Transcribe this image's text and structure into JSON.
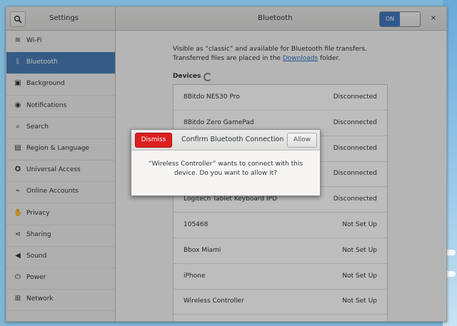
{
  "window": {
    "sidebar_title": "Settings",
    "title": "Bluetooth",
    "switch_label": "ON",
    "close_glyph": "×"
  },
  "sidebar": {
    "items": [
      {
        "label": "Wi-Fi",
        "icon": "wifi-icon",
        "glyph": "≋",
        "active": false
      },
      {
        "label": "Bluetooth",
        "icon": "bluetooth-icon",
        "glyph": "ᛒ",
        "active": true
      },
      {
        "label": "Background",
        "icon": "background-icon",
        "glyph": "▣",
        "active": false
      },
      {
        "label": "Notifications",
        "icon": "bell-icon",
        "glyph": "◉",
        "active": false
      },
      {
        "label": "Search",
        "icon": "search-icon",
        "glyph": "⌕",
        "active": false
      },
      {
        "label": "Region & Language",
        "icon": "flag-icon",
        "glyph": "▤",
        "active": false
      },
      {
        "label": "Universal Access",
        "icon": "accessibility-icon",
        "glyph": "✪",
        "active": false
      },
      {
        "label": "Online Accounts",
        "icon": "accounts-icon",
        "glyph": "⌁",
        "active": false
      },
      {
        "label": "Privacy",
        "icon": "privacy-icon",
        "glyph": "✋",
        "active": false
      },
      {
        "label": "Sharing",
        "icon": "share-icon",
        "glyph": "⋖",
        "active": false
      },
      {
        "label": "Sound",
        "icon": "speaker-icon",
        "glyph": "◀",
        "active": false
      },
      {
        "label": "Power",
        "icon": "power-icon",
        "glyph": "⏻",
        "active": false
      },
      {
        "label": "Network",
        "icon": "network-icon",
        "glyph": "⊞",
        "active": false
      }
    ]
  },
  "main": {
    "intro_before": "Visible as “classic” and available for Bluetooth file transfers. Transferred files are placed in the ",
    "intro_link": "Downloads",
    "intro_after": " folder.",
    "devices_heading": "Devices",
    "devices": [
      {
        "name": "8Bitdo NES30 Pro",
        "status": "Disconnected"
      },
      {
        "name": "8Bitdo Zero GamePad",
        "status": "Disconnected"
      },
      {
        "name": "",
        "status": "Disconnected"
      },
      {
        "name": "",
        "status": "Disconnected"
      },
      {
        "name": "Logitech Tablet Keyboard IPD",
        "status": "Disconnected"
      },
      {
        "name": "105468",
        "status": "Not Set Up"
      },
      {
        "name": "Bbox Miami",
        "status": "Not Set Up"
      },
      {
        "name": "iPhone",
        "status": "Not Set Up"
      },
      {
        "name": "Wireless Controller",
        "status": "Not Set Up"
      }
    ]
  },
  "dialog": {
    "dismiss_label": "Dismiss",
    "title": "Confirm Bluetooth Connection",
    "allow_label": "Allow",
    "message": "“Wireless Controller” wants to connect with this device. Do you want to allow it?"
  },
  "colors": {
    "accent": "#4a7db4",
    "switch_on": "#3e79bf",
    "dismiss": "#dc1e1e",
    "link": "#2a76c6"
  }
}
